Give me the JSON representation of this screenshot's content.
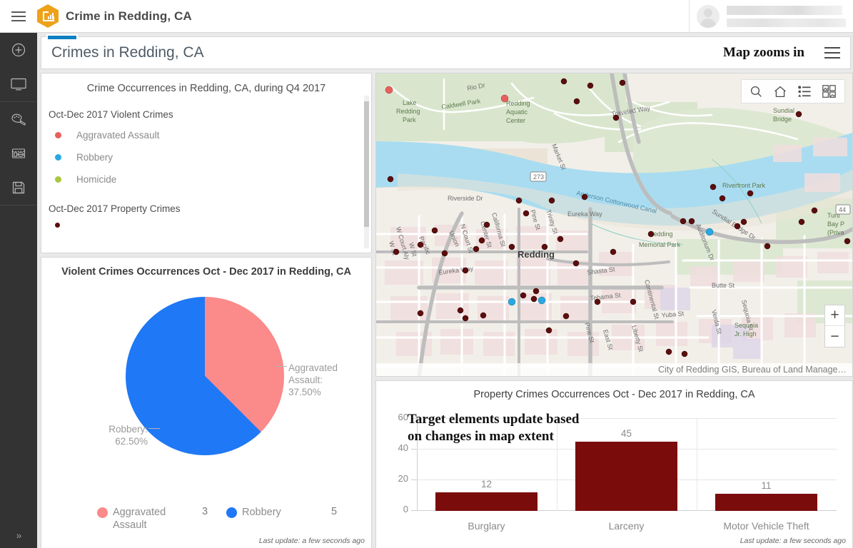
{
  "topbar": {
    "menu_icon": "hamburger-icon",
    "logo_icon": "operations-dashboard-logo-icon",
    "title": "Crime in Redding, CA",
    "user": {
      "avatar_icon": "user-avatar-icon",
      "name_redacted": "",
      "org_redacted": ""
    }
  },
  "rail": {
    "items": [
      {
        "icon": "add-element-icon",
        "label": "Add element"
      },
      {
        "icon": "display-icon",
        "label": "Display"
      },
      {
        "icon": "theme-palette-icon",
        "label": "Theme"
      },
      {
        "icon": "layout-icon",
        "label": "Layout"
      },
      {
        "icon": "save-icon",
        "label": "Save"
      }
    ],
    "expand_label": "»"
  },
  "dashboard_header": {
    "title": "Crimes in Redding, CA",
    "tab_handle_color": "#0f80c1",
    "menu_icon": "hamburger-icon"
  },
  "annotations": {
    "map_zooms_in": "Map zooms in",
    "target_elements": "Target elements update based\non changes in map extent",
    "target_line1": "Target elements update based",
    "target_line2": "on changes in map extent"
  },
  "legend_card": {
    "title": "Crime Occurrences in Redding, CA, during Q4 2017",
    "sections": [
      {
        "heading": "Oct-Dec 2017 Violent Crimes",
        "items": [
          {
            "label": "Aggravated Assault",
            "color": "#e8605d"
          },
          {
            "label": "Robbery",
            "color": "#29a8e0"
          },
          {
            "label": "Homicide",
            "color": "#a8c83c"
          }
        ]
      },
      {
        "heading": "Oct-Dec 2017 Property Crimes",
        "items": [
          {
            "label": "",
            "color": "#5c0d0d"
          }
        ]
      }
    ]
  },
  "pie_card": {
    "title": "Violent Crimes Occurrences Oct - Dec 2017 in Redding, CA",
    "label_right": "Aggravated\nAssault:\n37.50%",
    "label_right_l1": "Aggravated",
    "label_right_l2": "Assault:",
    "label_right_l3": "37.50%",
    "label_left_l1": "Robbery:",
    "label_left_l2": "62.50%",
    "last_update": "Last update: a few seconds ago",
    "legend": [
      {
        "name": "Aggravated Assault",
        "value": "3",
        "color": "#fb8a8a"
      },
      {
        "name": "Robbery",
        "value": "5",
        "color": "#1f78f5"
      }
    ]
  },
  "map_card": {
    "tools": [
      "search-icon",
      "home-icon",
      "legend-icon",
      "basemap-gallery-icon"
    ],
    "zoom_in": "+",
    "zoom_out": "−",
    "attribution": "City of Redding GIS, Bureau of Land Manage…",
    "place_labels": [
      "Lake\nRedding\nPark",
      "Caldwell Park",
      "Rio Dr",
      "Redding\nAquatic\nCenter",
      "Traveled Way",
      "Sundial\nBridge",
      "Riverfront Park",
      "Sundial Bridge Dr",
      "Turtle\nBay P\n(Priva",
      "Market St",
      "273",
      "Anderson Cottonwood Canal",
      "Riverside Dr",
      "Union",
      "Pacific",
      "N Court St",
      "W Court Aly",
      "W St",
      "W St",
      "California St",
      "Center St",
      "Trinity St",
      "Pine St",
      "Eureka Way",
      "Eureka Way",
      "Redding",
      "Shasta St",
      "Redding\nMemorial Park",
      "Auditorium Dr",
      "Tehama St",
      "Continental St",
      "Butte St",
      "44",
      "Liberty St",
      "East St",
      "Pine St",
      "Yuba St",
      "Verda St",
      "Sequoia St",
      "Sequoia\nJr. High"
    ]
  },
  "bar_card": {
    "title": "Property Crimes Occurrences Oct - Dec 2017 in Redding, CA",
    "last_update": "Last update: a few seconds ago"
  },
  "chart_data": [
    {
      "type": "pie",
      "title": "Violent Crimes Occurrences Oct - Dec 2017 in Redding, CA",
      "labels": [
        "Aggravated Assault",
        "Robbery"
      ],
      "values": [
        3,
        5
      ],
      "percents": [
        37.5,
        62.5
      ],
      "colors": [
        "#fb8a8a",
        "#1f78f5"
      ],
      "legend_position": "bottom",
      "annotations": [
        "Aggravated Assault: 37.50%",
        "Robbery: 62.50%"
      ]
    },
    {
      "type": "bar",
      "title": "Property Crimes Occurrences Oct - Dec 2017 in Redding, CA",
      "categories": [
        "Burglary",
        "Larceny",
        "Motor Vehicle Theft"
      ],
      "values": [
        12,
        45,
        11
      ],
      "xlabel": "",
      "ylabel": "",
      "ylim": [
        0,
        60
      ],
      "yticks": [
        0,
        20,
        40,
        60
      ],
      "grid": true,
      "bar_color": "#7b0c0c",
      "data_labels": [
        "12",
        "45",
        "11"
      ]
    }
  ]
}
